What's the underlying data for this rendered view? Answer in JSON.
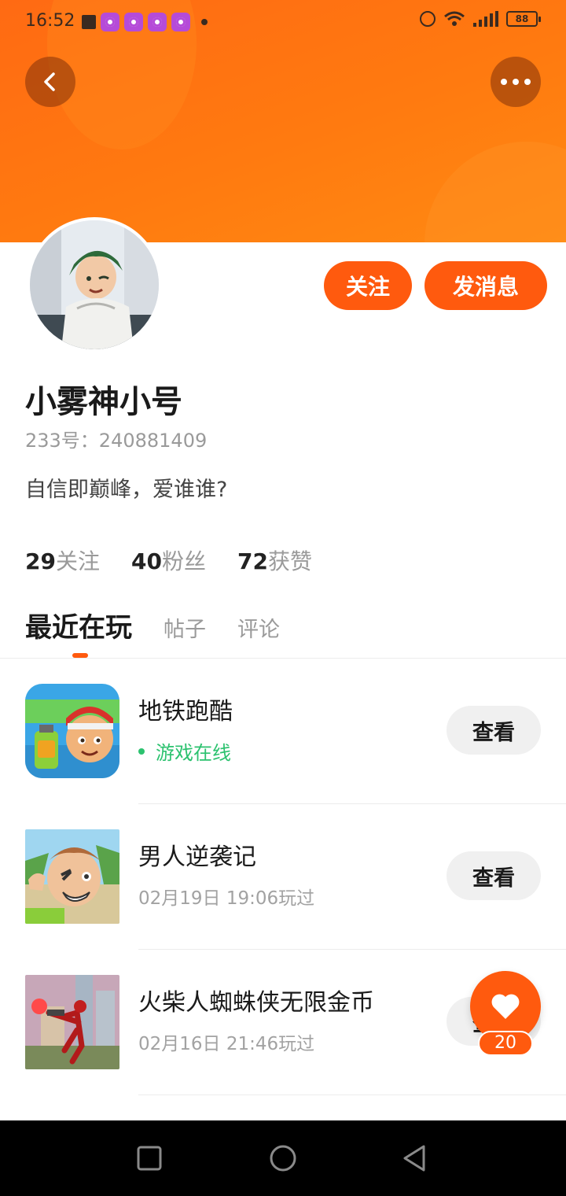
{
  "status_bar": {
    "time": "16:52",
    "battery": "88"
  },
  "profile": {
    "follow_label": "关注",
    "message_label": "发消息",
    "username": "小雾神小号",
    "user_id": "233号：240881409",
    "bio": "自信即巅峰，爱谁谁?"
  },
  "stats": [
    {
      "num": "29",
      "label": "关注"
    },
    {
      "num": "40",
      "label": "粉丝"
    },
    {
      "num": "72",
      "label": "获赞"
    }
  ],
  "tabs": {
    "active": "最近在玩",
    "posts": "帖子",
    "comments": "评论"
  },
  "games": [
    {
      "title": "地铁跑酷",
      "status": "游戏在线",
      "button": "查看"
    },
    {
      "title": "男人逆袭记",
      "subtitle": "02月19日 19:06玩过",
      "button": "查看"
    },
    {
      "title": "火柴人蜘蛛侠无限金币",
      "subtitle": "02月16日 21:46玩过",
      "button": "查看"
    }
  ],
  "like": {
    "count": "20"
  },
  "colors": {
    "accent": "#ff5a0e",
    "online": "#2cc26f",
    "header": "#ff7a10"
  }
}
